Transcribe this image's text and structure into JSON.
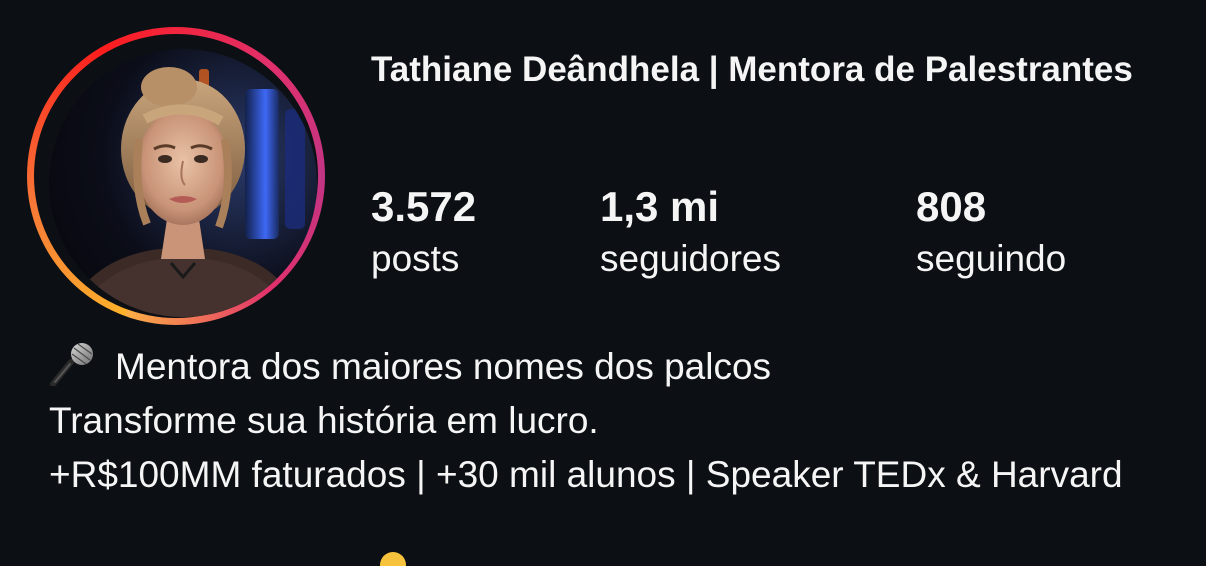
{
  "profile": {
    "name": "Tathiane Deândhela | Mentora de Palestrantes"
  },
  "stats": {
    "posts": {
      "value": "3.572",
      "label": "posts"
    },
    "followers": {
      "value": "1,3 mi",
      "label": "seguidores"
    },
    "following": {
      "value": "808",
      "label": "seguindo"
    }
  },
  "bio": {
    "line1_icon": "microphone-icon",
    "line1": "Mentora dos maiores nomes dos palcos",
    "line2": "Transforme sua história em lucro.",
    "line3": "+R$100MM faturados | +30 mil alunos | Speaker TEDx & Harvard"
  },
  "colors": {
    "background": "#0c1014",
    "text": "#f5f5f5",
    "ring_gradient": [
      "#fdb22b",
      "#f77737",
      "#fd1d1d",
      "#e1306c",
      "#c13584"
    ]
  }
}
